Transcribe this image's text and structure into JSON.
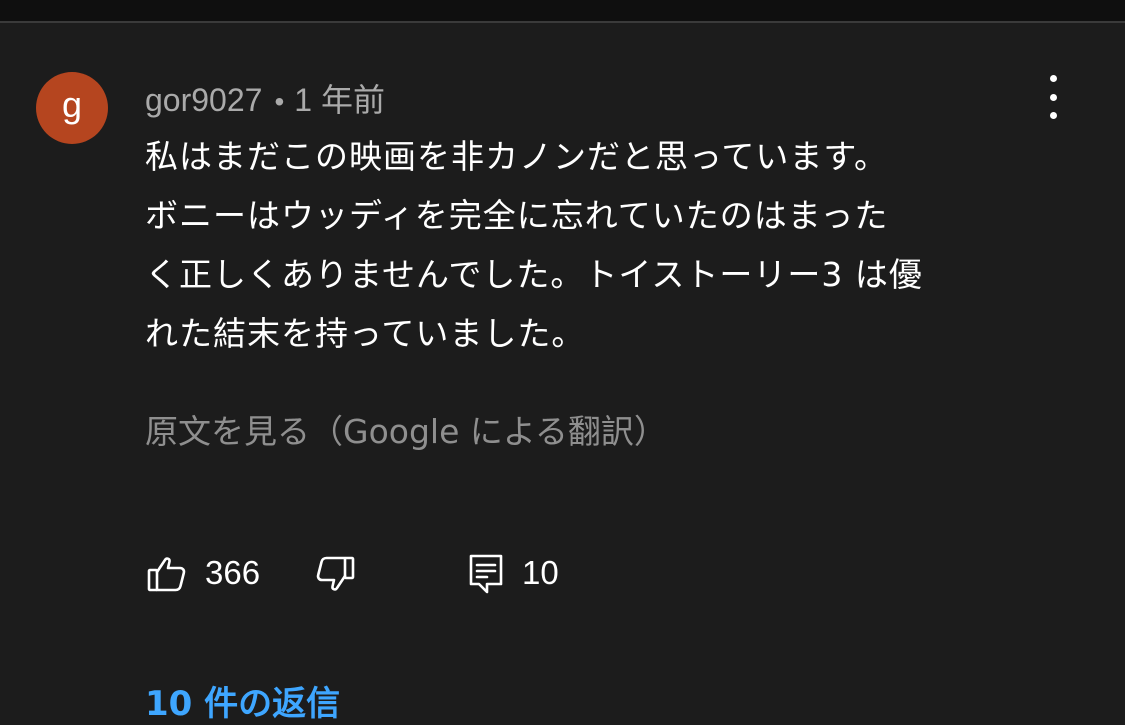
{
  "comment": {
    "avatar_letter": "g",
    "avatar_color": "#b5451f",
    "author": "gor9027",
    "separator": "•",
    "timestamp": "1 年前",
    "lines": [
      "私はまだこの映画を非カノンだと思っています。",
      "ボニーはウッディを完全に忘れていたのはまった",
      "く正しくありませんでした。トイストーリー3 は優",
      "れた結末を持っていました。"
    ],
    "translate_label": "原文を見る（Google による翻訳）",
    "like_count": "366",
    "reply_count": "10",
    "replies_label": "10 件の返信"
  },
  "icons": {
    "like": "thumbs-up-icon",
    "dislike": "thumbs-down-icon",
    "reply": "comment-icon",
    "menu": "more-vertical-icon"
  },
  "colors": {
    "background": "#1c1c1c",
    "link_blue": "#3ea6ff",
    "secondary_text": "#aaaaaa"
  }
}
